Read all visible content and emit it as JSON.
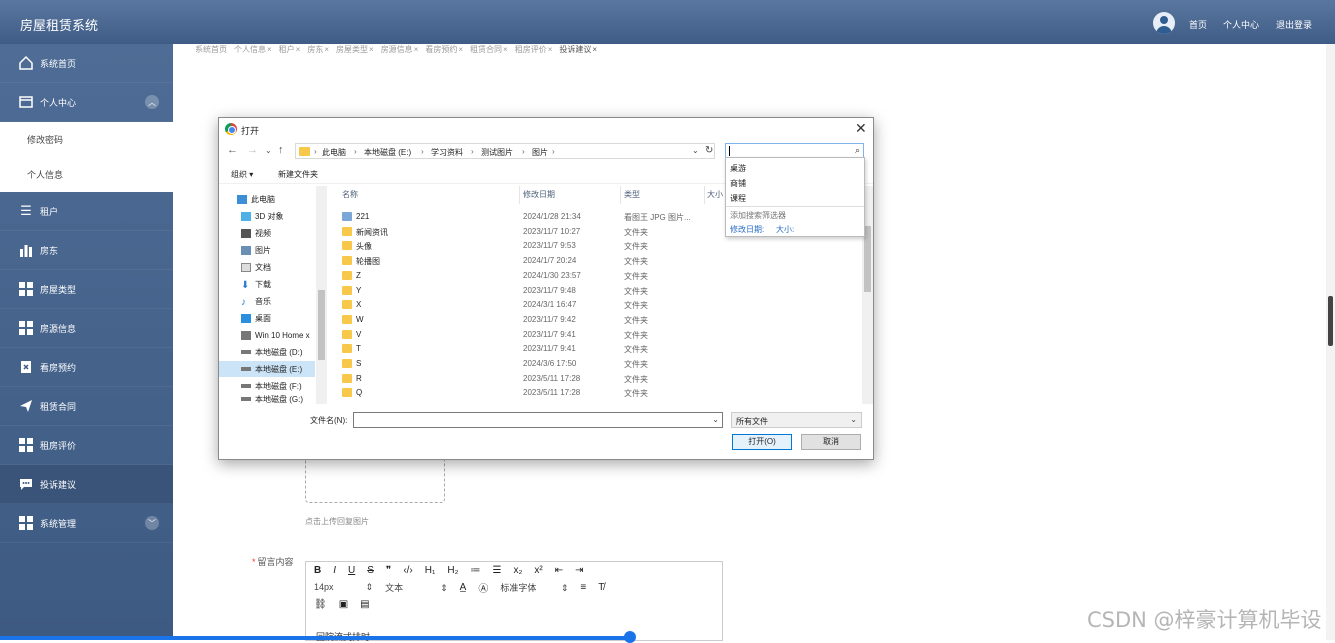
{
  "header": {
    "app_title": "房屋租赁系统",
    "nav": [
      "首页",
      "个人中心",
      "退出登录"
    ]
  },
  "sidebar": {
    "items": [
      {
        "label": "系统首页",
        "icon": "home-icon"
      },
      {
        "label": "个人中心",
        "icon": "card-icon",
        "expanded": true
      },
      {
        "label": "修改密码",
        "sub": true
      },
      {
        "label": "个人信息",
        "sub": true
      },
      {
        "label": "租户",
        "icon": "list-icon"
      },
      {
        "label": "房东",
        "icon": "bar-chart-icon"
      },
      {
        "label": "房屋类型",
        "icon": "grid-icon"
      },
      {
        "label": "房源信息",
        "icon": "grid-icon"
      },
      {
        "label": "看房预约",
        "icon": "doc-x-icon"
      },
      {
        "label": "租赁合同",
        "icon": "send-icon"
      },
      {
        "label": "租房评价",
        "icon": "grid-icon"
      },
      {
        "label": "投诉建议",
        "icon": "chat-icon",
        "active": true
      },
      {
        "label": "系统管理",
        "icon": "grid-icon",
        "expandable": true
      }
    ]
  },
  "tabs": [
    "系统首页",
    "个人信息",
    "租户",
    "房东",
    "房屋类型",
    "房源信息",
    "看房预约",
    "租赁合同",
    "租房评价",
    "投诉建议"
  ],
  "form": {
    "upload_tip": "点击上传回复图片",
    "message_label": "留言内容",
    "editor_font_size": "14px",
    "editor_block": "文本",
    "editor_font": "标准字体",
    "editor_content": "回院流式排时"
  },
  "dialog": {
    "title": "打开",
    "path": [
      "此电脑",
      "本地磁盘 (E:)",
      "学习资料",
      "测试图片",
      "图片"
    ],
    "commands": [
      "组织 ▾",
      "新建文件夹"
    ],
    "nav_pane": [
      "此电脑",
      "3D 对象",
      "视频",
      "图片",
      "文档",
      "下载",
      "音乐",
      "桌面",
      "Win 10 Home x",
      "本地磁盘 (D:)",
      "本地磁盘 (E:)",
      "本地磁盘 (F:)",
      "本地磁盘 (G:)"
    ],
    "columns": [
      "名称",
      "修改日期",
      "类型",
      "大小"
    ],
    "files": [
      {
        "name": "221",
        "date": "2024/1/28 21:34",
        "type": "看图王 JPG 图片...",
        "img": true
      },
      {
        "name": "新闻资讯",
        "date": "2023/11/7 10:27",
        "type": "文件夹"
      },
      {
        "name": "头像",
        "date": "2023/11/7 9:53",
        "type": "文件夹"
      },
      {
        "name": "轮播图",
        "date": "2024/1/7 20:24",
        "type": "文件夹"
      },
      {
        "name": "Z",
        "date": "2024/1/30 23:57",
        "type": "文件夹"
      },
      {
        "name": "Y",
        "date": "2023/11/7 9:48",
        "type": "文件夹"
      },
      {
        "name": "X",
        "date": "2024/3/1 16:47",
        "type": "文件夹"
      },
      {
        "name": "W",
        "date": "2023/11/7 9:42",
        "type": "文件夹"
      },
      {
        "name": "V",
        "date": "2023/11/7 9:41",
        "type": "文件夹"
      },
      {
        "name": "T",
        "date": "2023/11/7 9:41",
        "type": "文件夹"
      },
      {
        "name": "S",
        "date": "2024/3/6 17:50",
        "type": "文件夹"
      },
      {
        "name": "R",
        "date": "2023/5/11 17:28",
        "type": "文件夹"
      },
      {
        "name": "Q",
        "date": "2023/5/11 17:28",
        "type": "文件夹"
      }
    ],
    "suggestions": [
      "桌游",
      "商铺",
      "课程"
    ],
    "suggest_hint": "添加搜索筛选器",
    "suggest_filters": [
      "修改日期:",
      "大小:"
    ],
    "filename_label": "文件名(N):",
    "filetype": "所有文件",
    "open_label": "打开(O)",
    "cancel_label": "取消"
  },
  "watermark": "CSDN @梓豪计算机毕设"
}
